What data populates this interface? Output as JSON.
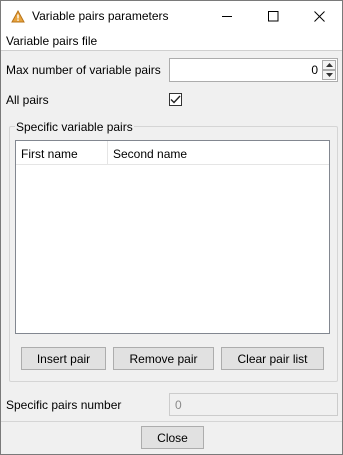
{
  "window": {
    "title": "Variable pairs parameters"
  },
  "menu": {
    "file": "Variable pairs file"
  },
  "form": {
    "max_pairs_label": "Max number of variable pairs",
    "max_pairs_value": "0",
    "all_pairs_label": "All pairs",
    "all_pairs_checked": true,
    "group_title": "Specific variable pairs",
    "columns": [
      "First name",
      "Second name"
    ],
    "rows": [],
    "specific_count_label": "Specific pairs number",
    "specific_count_value": "0"
  },
  "buttons": {
    "insert": "Insert pair",
    "remove": "Remove pair",
    "clear": "Clear pair list",
    "close": "Close"
  },
  "icons": {
    "app": "warning-triangle-icon",
    "minimize": "minimize-icon",
    "maximize": "maximize-icon",
    "close": "close-icon",
    "spin_up": "chevron-up-icon",
    "spin_down": "chevron-down-icon",
    "check": "checkmark-icon"
  },
  "colors": {
    "app_icon": "#e8a33c"
  }
}
